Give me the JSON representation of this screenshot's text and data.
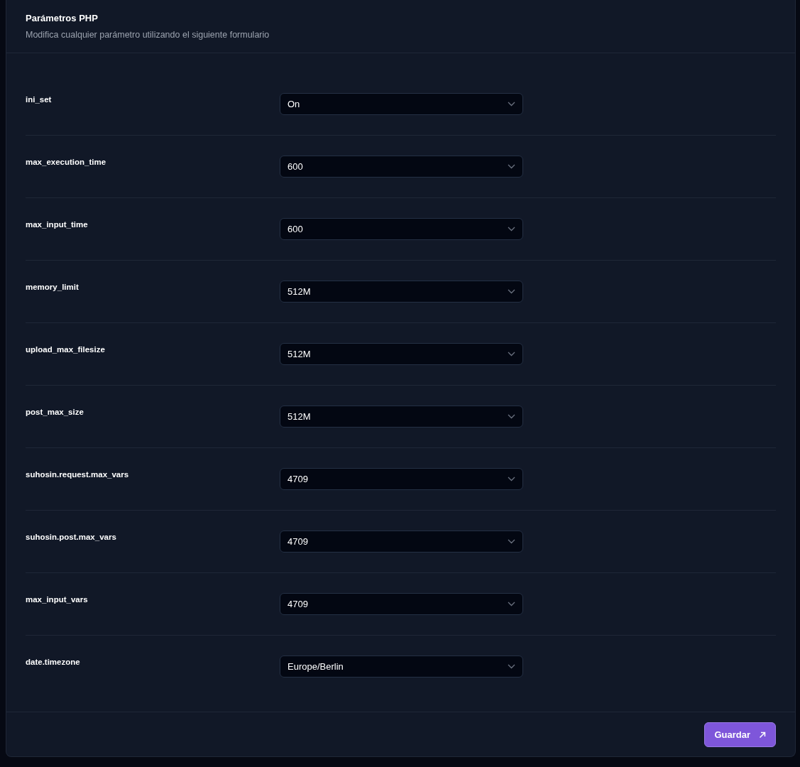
{
  "card": {
    "title": "Parámetros PHP",
    "subtitle": "Modifica cualquier parámetro utilizando el siguiente formulario"
  },
  "params": [
    {
      "name": "ini_set",
      "value": "On"
    },
    {
      "name": "max_execution_time",
      "value": "600"
    },
    {
      "name": "max_input_time",
      "value": "600"
    },
    {
      "name": "memory_limit",
      "value": "512M"
    },
    {
      "name": "upload_max_filesize",
      "value": "512M"
    },
    {
      "name": "post_max_size",
      "value": "512M"
    },
    {
      "name": "suhosin.request.max_vars",
      "value": "4709"
    },
    {
      "name": "suhosin.post.max_vars",
      "value": "4709"
    },
    {
      "name": "max_input_vars",
      "value": "4709"
    },
    {
      "name": "date.timezone",
      "value": "Europe/Berlin"
    }
  ],
  "save_button": "Guardar"
}
